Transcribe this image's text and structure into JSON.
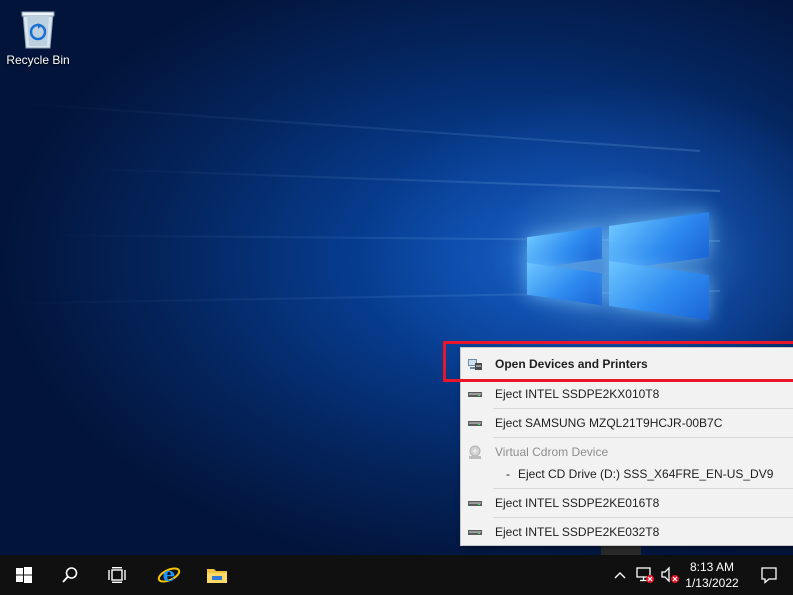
{
  "desktop": {
    "icons": [
      {
        "label": "Recycle Bin",
        "icon": "recycle-bin-icon"
      }
    ]
  },
  "context_menu": {
    "items": [
      {
        "label": "Open Devices and Printers",
        "bold": true,
        "icon": "devices-printers-icon"
      },
      {
        "label": "Eject INTEL SSDPE2KX010T8",
        "icon": "drive-icon"
      },
      {
        "label": "Eject SAMSUNG MZQL21T9HCJR-00B7C",
        "icon": "drive-icon"
      },
      {
        "label": "Virtual Cdrom Device",
        "disabled": true,
        "icon": "cdrom-icon"
      },
      {
        "label": "Eject CD Drive (D:) SSS_X64FRE_EN-US_DV9",
        "prefix": "-"
      },
      {
        "label": "Eject INTEL SSDPE2KE016T8",
        "icon": "drive-icon"
      },
      {
        "label": "Eject INTEL SSDPE2KE032T8",
        "icon": "drive-icon"
      }
    ],
    "highlight_color": "#e8162a"
  },
  "taskbar": {
    "buttons": [
      "start-icon",
      "search-icon",
      "task-view-icon",
      "internet-explorer-icon",
      "file-explorer-icon"
    ],
    "tray": [
      "chevron-up-icon",
      "network-disconnected-icon",
      "volume-muted-icon"
    ],
    "clock": {
      "time": "8:13 AM",
      "date": "1/13/2022"
    },
    "notification": "action-center-icon"
  }
}
